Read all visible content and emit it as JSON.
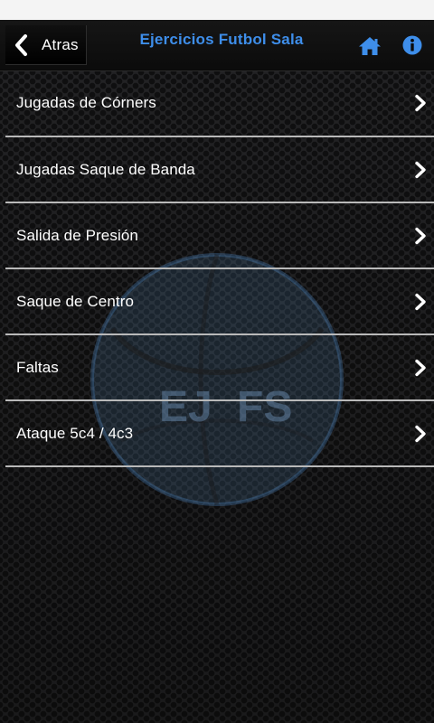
{
  "header": {
    "back_label": "Atras",
    "title": "Ejercicios Futbol Sala",
    "home_icon": "home-icon",
    "info_icon": "info-icon"
  },
  "menu": {
    "items": [
      {
        "label": "Jugadas de Córners"
      },
      {
        "label": "Jugadas Saque de Banda"
      },
      {
        "label": "Salida de Presión"
      },
      {
        "label": "Saque de Centro"
      },
      {
        "label": "Faltas"
      },
      {
        "label": "Ataque 5c4 / 4c3"
      }
    ]
  },
  "watermark": {
    "left_text": "EJ",
    "right_text": "FS"
  },
  "colors": {
    "accent": "#3e8eea",
    "text": "#ffffff",
    "divider": "#b9b9b9",
    "background": "#1b1b1c"
  }
}
